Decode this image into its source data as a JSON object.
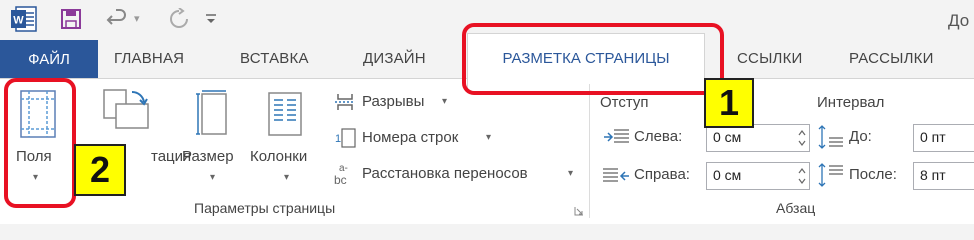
{
  "title_bar": {
    "doc_title": "До",
    "icons": [
      "word-icon",
      "save-icon",
      "undo-icon",
      "redo-icon",
      "customize-qat-icon"
    ]
  },
  "tabs": {
    "file": "ФАЙЛ",
    "home": "ГЛАВНАЯ",
    "insert": "ВСТАВКА",
    "design": "ДИЗАЙН",
    "layout": "РАЗМЕТКА СТРАНИЦЫ",
    "references": "ССЫЛКИ",
    "mailings": "РАССЫЛКИ"
  },
  "page_setup": {
    "margins_label": "Поля",
    "orientation_label": "тация",
    "size_label": "Размер",
    "columns_label": "Колонки",
    "breaks_label": "Разрывы",
    "line_numbers_label": "Номера строк",
    "hyphenation_label": "Расстановка переносов",
    "group_label": "Параметры страницы"
  },
  "paragraph": {
    "indent_header": "Отступ",
    "left_label": "Слева:",
    "left_value": "0 см",
    "right_label": "Справа:",
    "right_value": "0 см",
    "spacing_header": "Интервал",
    "before_label": "До:",
    "before_value": "0 пт",
    "after_label": "После:",
    "after_value": "8 пт",
    "group_label": "Абзац"
  },
  "callouts": {
    "one": "1",
    "two": "2",
    "highlight_color": "#e81123",
    "badge_color": "#ffff00"
  },
  "colors": {
    "file_tab": "#2b579a",
    "accent": "#2b579a"
  }
}
